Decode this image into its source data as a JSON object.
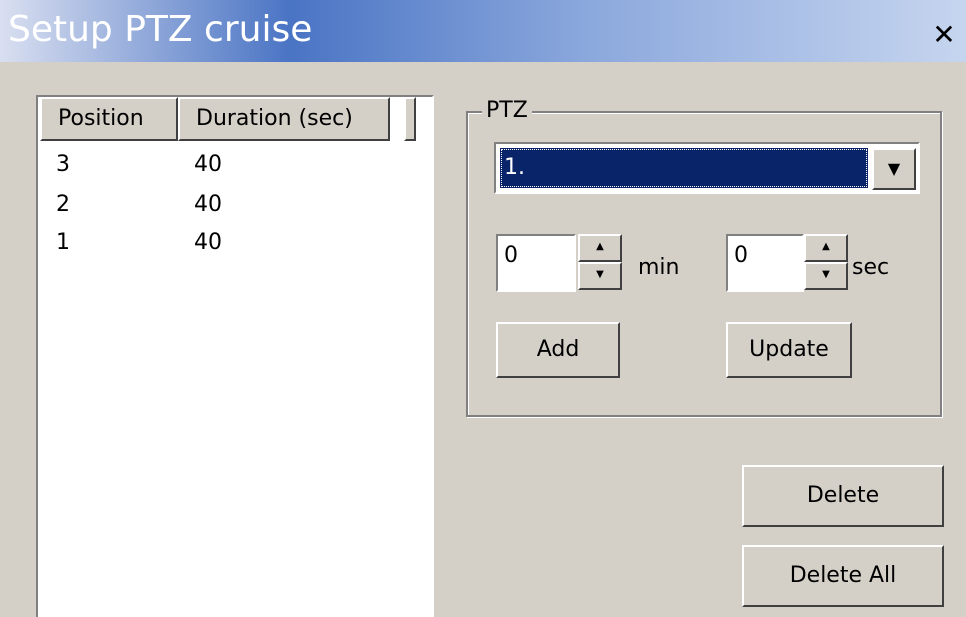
{
  "window": {
    "title": "Setup PTZ cruise",
    "close_glyph": "✕"
  },
  "list": {
    "columns": [
      "Position",
      "Duration (sec)"
    ],
    "rows": [
      {
        "position": "3",
        "duration": "40"
      },
      {
        "position": "2",
        "duration": "40"
      },
      {
        "position": "1",
        "duration": "40"
      }
    ]
  },
  "ptz": {
    "group_label": "PTZ",
    "preset_value": "1.",
    "min_value": "0",
    "min_unit": "min",
    "sec_value": "0",
    "sec_unit": "sec",
    "add_label": "Add",
    "update_label": "Update"
  },
  "actions": {
    "delete_label": "Delete",
    "delete_all_label": "Delete All"
  },
  "icons": {
    "close": "close-icon",
    "dropdown": "chevron-down-icon",
    "spin_up": "arrow-up-icon",
    "spin_down": "arrow-down-icon"
  }
}
